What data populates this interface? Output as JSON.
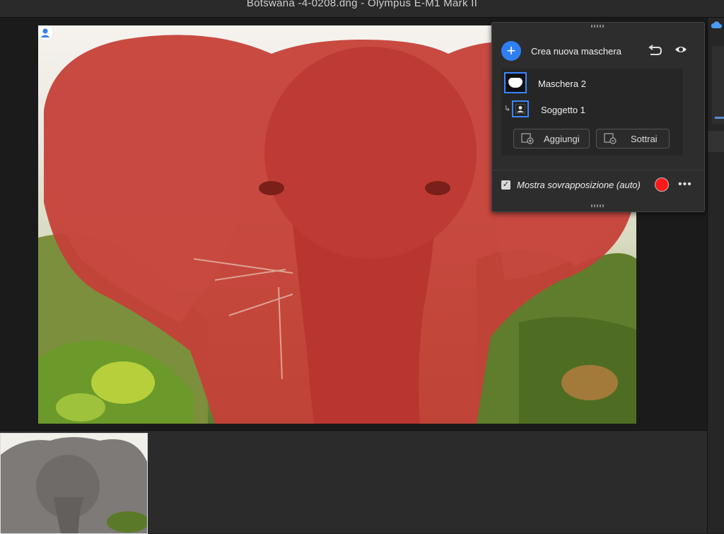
{
  "window": {
    "title": "Botswana -4-0208.dng  -  Olympus E-M1 Mark II"
  },
  "mask_panel": {
    "create_label": "Crea nuova maschera",
    "add_icon": "plus-icon",
    "masks": [
      {
        "name": "Maschera 2"
      },
      {
        "name": "Soggetto 1"
      }
    ],
    "add_button": "Aggiungi",
    "subtract_button": "Sottrai",
    "overlay_label": "Mostra sovrapposizione (auto)",
    "overlay_checked": true,
    "overlay_color": "#ff1a1a"
  },
  "colors": {
    "accent": "#2f7ef4",
    "overlay": "#c0392b"
  }
}
